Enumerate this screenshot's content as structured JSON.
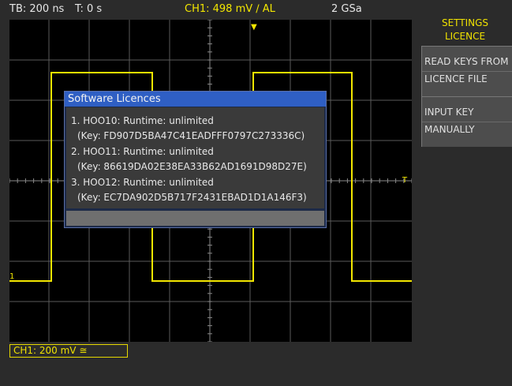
{
  "status": {
    "timebase": "TB: 200 ns",
    "trigger_time": "T: 0 s",
    "channel_info": "CH1: 498 mV ∕ AL",
    "sample_rate": "2 GSa"
  },
  "side_panel": {
    "title_line1": "SETTINGS",
    "title_line2": "LICENCE",
    "buttons": [
      {
        "line1": "READ KEYS FROM",
        "line2": "LICENCE FILE"
      },
      {
        "line1": "INPUT KEY",
        "line2": "MANUALLY"
      }
    ]
  },
  "dialog": {
    "title": "Software Licences",
    "licences": [
      {
        "line": "1. HOO10: Runtime: unlimited",
        "key": "(Key: FD907D5BA47C41EADFFF0797C273336C)"
      },
      {
        "line": "2. HOO11: Runtime: unlimited",
        "key": "(Key: 86619DA02E38EA33B62AD1691D98D27E)"
      },
      {
        "line": "3. HOO12: Runtime: unlimited",
        "key": "(Key: EC7DA902D5B717F2431EBAD1D1A146F3)"
      }
    ]
  },
  "channel_box": {
    "label": "CH1: 200 mV ≅"
  },
  "markers": {
    "channel_marker": "1",
    "trigger_marker": "T"
  },
  "colors": {
    "trace": "#f2e600",
    "grid": "#5a5a5a",
    "dialog_title": "#2f5fc4"
  }
}
